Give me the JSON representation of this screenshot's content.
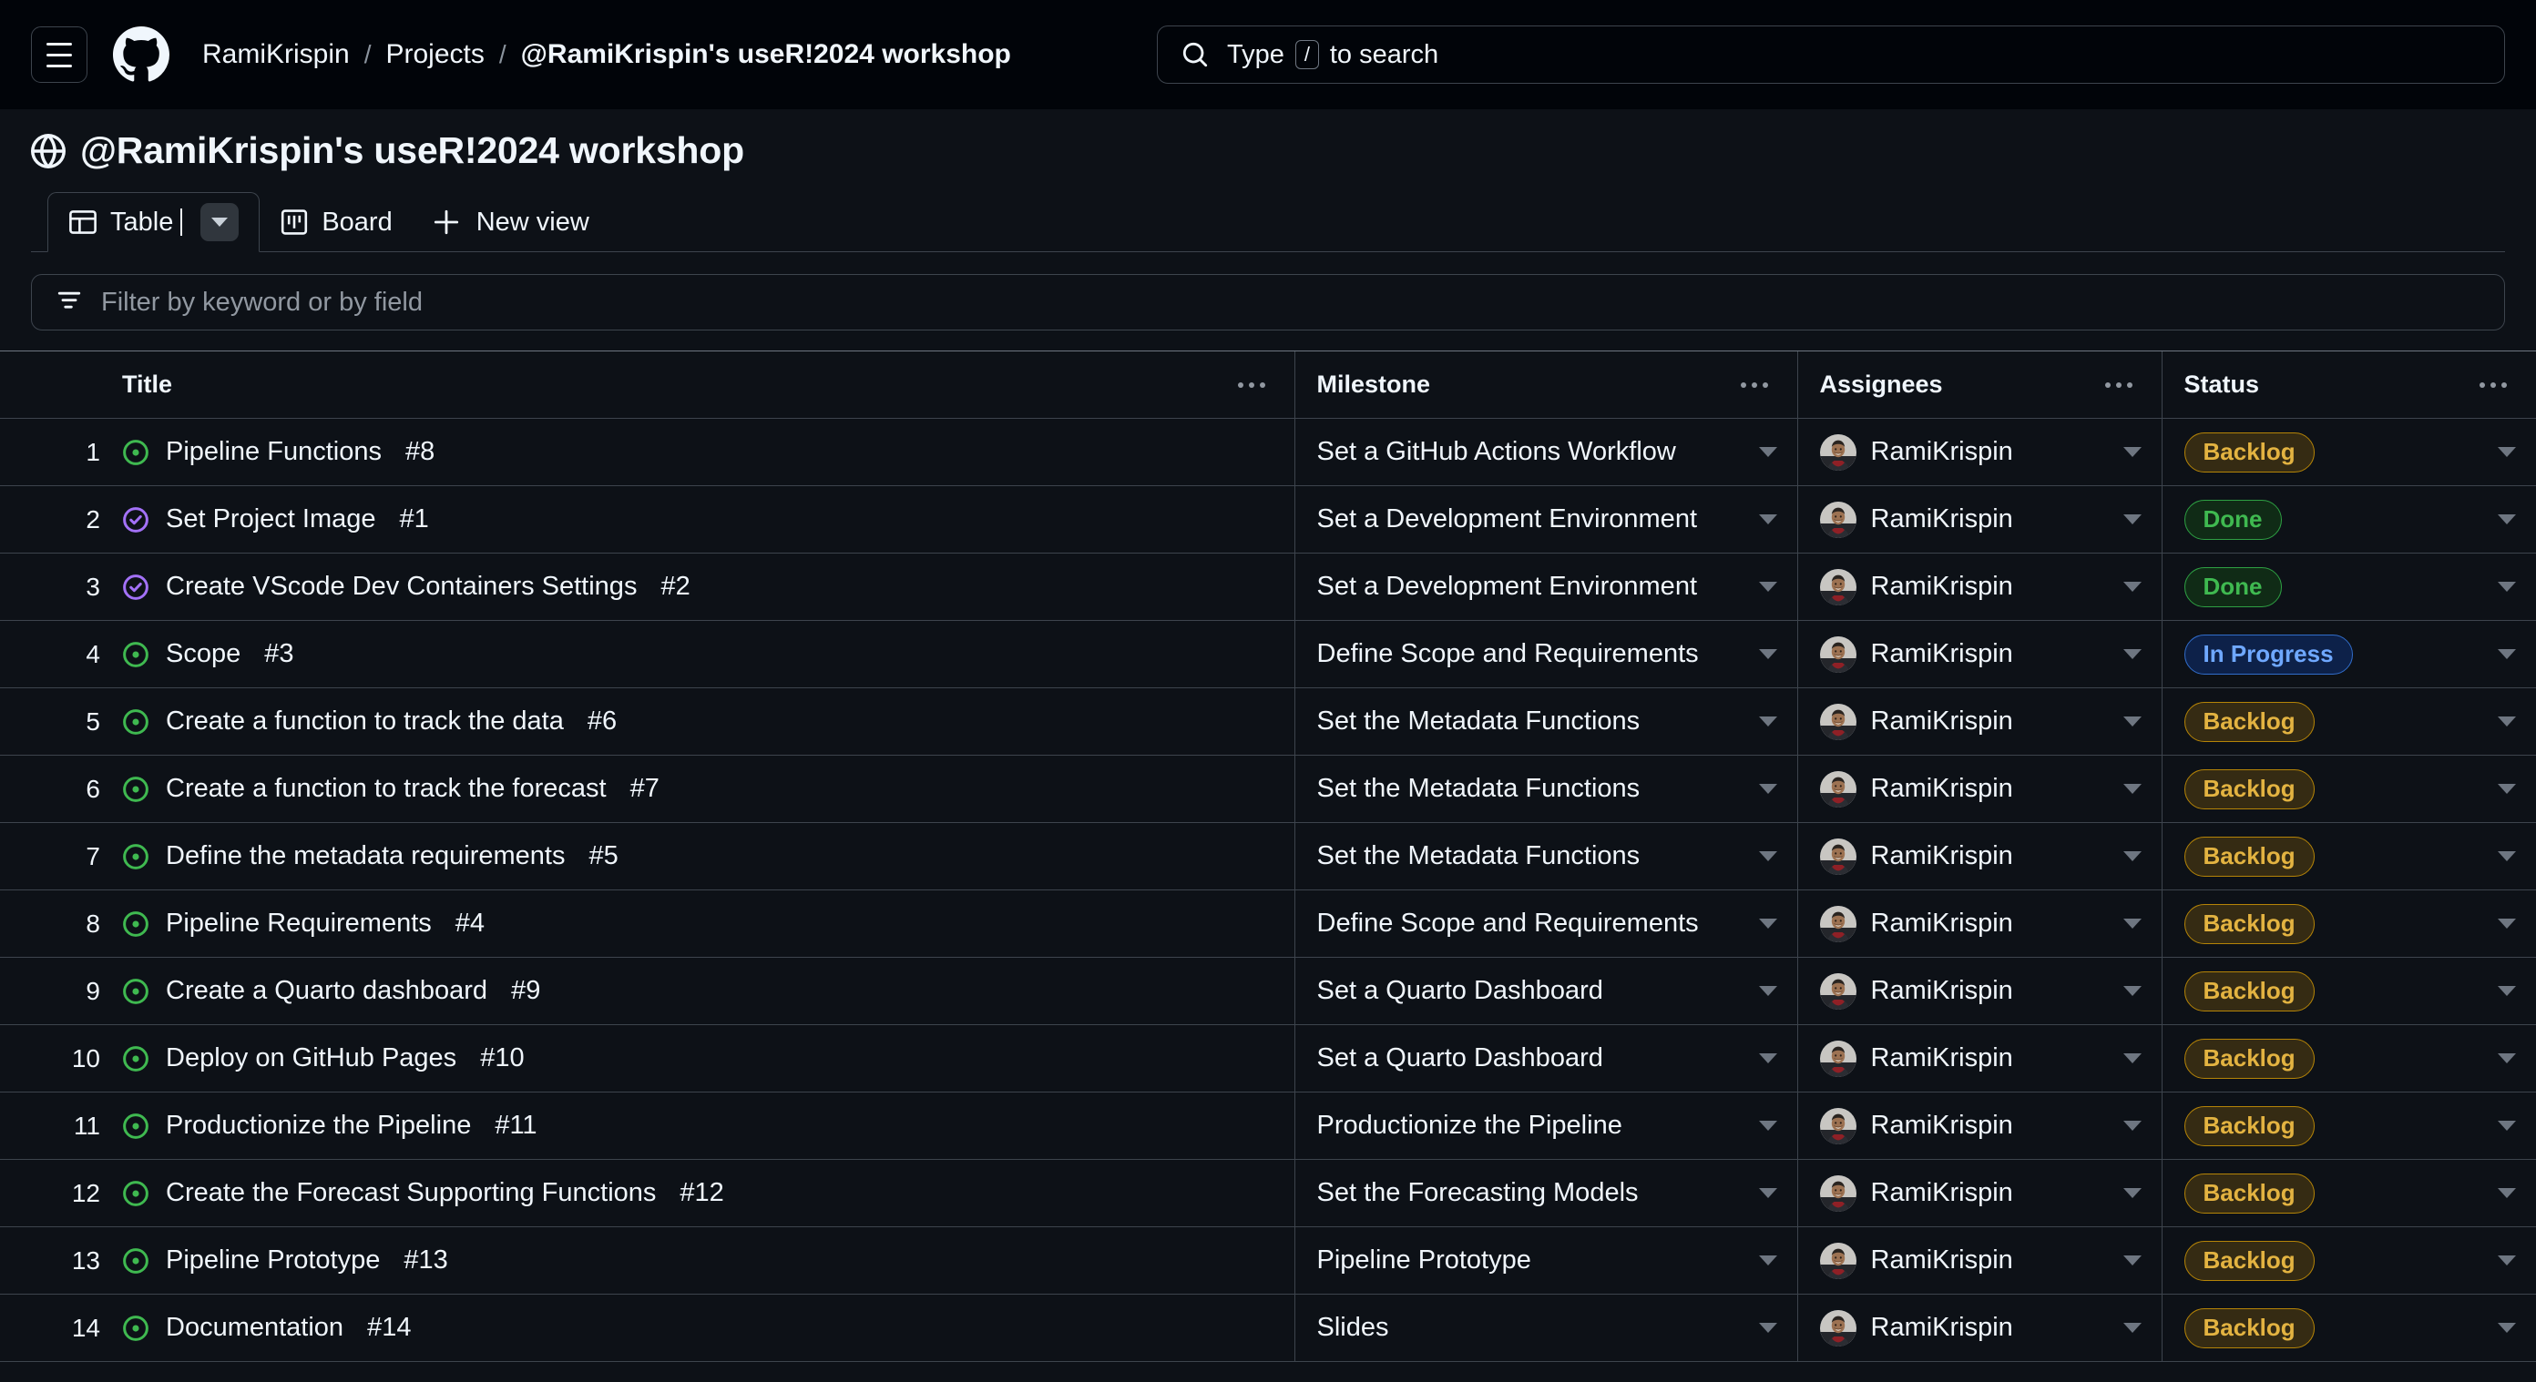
{
  "header": {
    "menu_label": "Open navigation menu",
    "breadcrumb": {
      "owner": "RamiKrispin",
      "section": "Projects",
      "project": "@RamiKrispin's useR!2024 workshop",
      "separator": "/"
    },
    "search": {
      "placeholder_prefix": "Type",
      "key_hint": "/",
      "placeholder_suffix": "to search"
    }
  },
  "project": {
    "title": "@RamiKrispin's useR!2024 workshop",
    "visibility_icon": "globe-icon"
  },
  "tabs": [
    {
      "label": "Table",
      "icon": "table-icon",
      "active": true
    },
    {
      "label": "Board",
      "icon": "board-icon",
      "active": false
    }
  ],
  "new_view": {
    "label": "New view",
    "icon": "plus-icon"
  },
  "filter": {
    "placeholder": "Filter by keyword or by field",
    "icon": "filter-icon"
  },
  "table": {
    "columns": [
      {
        "key": "title",
        "label": "Title"
      },
      {
        "key": "milestone",
        "label": "Milestone"
      },
      {
        "key": "assignees",
        "label": "Assignees"
      },
      {
        "key": "status",
        "label": "Status"
      }
    ],
    "rows": [
      {
        "num": "1",
        "icon": "issue-open-icon",
        "title": "Pipeline Functions",
        "issue": "#8",
        "milestone": "Set a GitHub Actions Workflow",
        "assignee": "RamiKrispin",
        "status": "Backlog"
      },
      {
        "num": "2",
        "icon": "issue-closed-icon",
        "title": "Set Project Image",
        "issue": "#1",
        "milestone": "Set a Development Environment",
        "assignee": "RamiKrispin",
        "status": "Done"
      },
      {
        "num": "3",
        "icon": "issue-closed-icon",
        "title": "Create VScode Dev Containers Settings",
        "issue": "#2",
        "milestone": "Set a Development Environment",
        "assignee": "RamiKrispin",
        "status": "Done"
      },
      {
        "num": "4",
        "icon": "issue-open-icon",
        "title": "Scope",
        "issue": "#3",
        "milestone": "Define Scope and Requirements",
        "assignee": "RamiKrispin",
        "status": "In Progress"
      },
      {
        "num": "5",
        "icon": "issue-open-icon",
        "title": "Create a function to track the data",
        "issue": "#6",
        "milestone": "Set the Metadata Functions",
        "assignee": "RamiKrispin",
        "status": "Backlog"
      },
      {
        "num": "6",
        "icon": "issue-open-icon",
        "title": "Create a function to track the forecast",
        "issue": "#7",
        "milestone": "Set the Metadata Functions",
        "assignee": "RamiKrispin",
        "status": "Backlog"
      },
      {
        "num": "7",
        "icon": "issue-open-icon",
        "title": "Define the metadata requirements",
        "issue": "#5",
        "milestone": "Set the Metadata Functions",
        "assignee": "RamiKrispin",
        "status": "Backlog"
      },
      {
        "num": "8",
        "icon": "issue-open-icon",
        "title": "Pipeline Requirements",
        "issue": "#4",
        "milestone": "Define Scope and Requirements",
        "assignee": "RamiKrispin",
        "status": "Backlog"
      },
      {
        "num": "9",
        "icon": "issue-open-icon",
        "title": "Create a Quarto dashboard",
        "issue": "#9",
        "milestone": "Set a Quarto Dashboard",
        "assignee": "RamiKrispin",
        "status": "Backlog"
      },
      {
        "num": "10",
        "icon": "issue-open-icon",
        "title": "Deploy on GitHub Pages",
        "issue": "#10",
        "milestone": "Set a Quarto Dashboard",
        "assignee": "RamiKrispin",
        "status": "Backlog"
      },
      {
        "num": "11",
        "icon": "issue-open-icon",
        "title": "Productionize the Pipeline",
        "issue": "#11",
        "milestone": "Productionize the Pipeline",
        "assignee": "RamiKrispin",
        "status": "Backlog"
      },
      {
        "num": "12",
        "icon": "issue-open-icon",
        "title": "Create the Forecast Supporting Functions",
        "issue": "#12",
        "milestone": "Set the Forecasting Models",
        "assignee": "RamiKrispin",
        "status": "Backlog"
      },
      {
        "num": "13",
        "icon": "issue-open-icon",
        "title": "Pipeline Prototype",
        "issue": "#13",
        "milestone": "Pipeline Prototype",
        "assignee": "RamiKrispin",
        "status": "Backlog"
      },
      {
        "num": "14",
        "icon": "issue-open-icon",
        "title": "Documentation",
        "issue": "#14",
        "milestone": "Slides",
        "assignee": "RamiKrispin",
        "status": "Backlog"
      }
    ]
  },
  "colors": {
    "page_bg": "#0d1117",
    "header_bg": "#010409",
    "border": "#3d444d",
    "text": "#f0f6fc",
    "muted": "#9198a1",
    "open_issue_green": "#3fb950",
    "closed_issue_purple": "#a371f7",
    "status_backlog": "#e3b341",
    "status_done": "#3fb950",
    "status_inprogress": "#6fa8ff"
  }
}
